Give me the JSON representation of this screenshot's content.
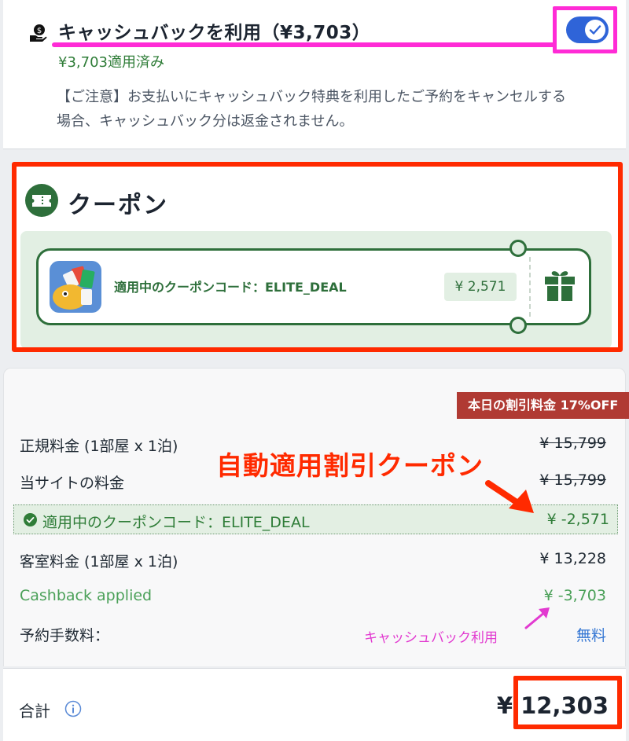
{
  "cashback": {
    "title": "キャッシュバックを利用（¥3,703）",
    "applied": "¥3,703適用済み",
    "notice": "【ご注意】お支払いにキャッシュバック特典を利用したご予約をキャンセルする場合、キャッシュバック分は返金されません。",
    "toggle_on": true,
    "icon": "money-hand-icon"
  },
  "coupon": {
    "title": "クーポン",
    "label": "適用中のクーポンコード：ELITE_DEAL",
    "amount": "¥ 2,571",
    "icons": [
      "ticket-icon",
      "gift-icon"
    ]
  },
  "price": {
    "badge": "本日の割引料金 17%OFF",
    "rows": [
      {
        "label": "正規料金 (1部屋 x 1泊)",
        "value": "¥ 15,799"
      },
      {
        "label": "当サイトの料金",
        "value": "¥ 15,799"
      },
      {
        "label": "適用中のクーポンコード：ELITE_DEAL",
        "value": "¥ -2,571"
      },
      {
        "label": "客室料金 (1部屋 x 1泊)",
        "value": "¥ 13,228"
      },
      {
        "label": "Cashback applied",
        "value": "¥ -3,703"
      },
      {
        "label": "予約手数料：",
        "value": "無料"
      }
    ]
  },
  "total": {
    "label": "合計",
    "value": "¥ 12,303"
  },
  "annotations": {
    "auto_coupon": "自動適用割引クーポン",
    "cashback_use": "キャッシュバック利用"
  },
  "colors": {
    "accent_green": "#2e6f3b",
    "toggle_blue": "#2f64d8",
    "badge_red": "#b03a33",
    "annotation_red": "#ff2a00",
    "annotation_magenta": "#ff2bd6"
  }
}
